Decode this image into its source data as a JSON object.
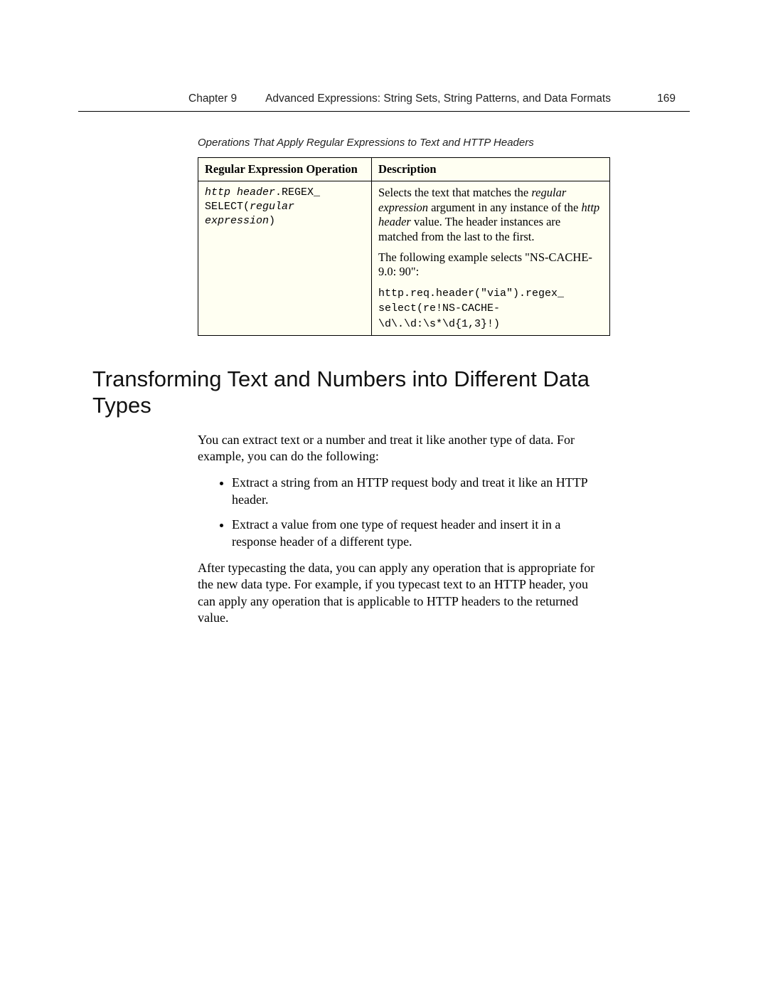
{
  "header": {
    "chapter": "Chapter 9",
    "title": "Advanced Expressions: String Sets, String Patterns, and Data Formats",
    "page": "169"
  },
  "table": {
    "caption": "Operations That Apply Regular Expressions to Text and HTTP Headers",
    "columns": [
      "Regular Expression Operation",
      "Description"
    ],
    "row": {
      "op_prefix_i": "http header",
      "op_mid": ".REGEX_ SELECT(",
      "op_arg_i": "regular expression",
      "op_suffix": ")",
      "desc_p1_a": "Selects the text that matches the ",
      "desc_p1_i1": "regular expression",
      "desc_p1_b": " argument in any instance of the ",
      "desc_p1_i2": "http header",
      "desc_p1_c": " value. The header instances are matched from the last to the first.",
      "desc_p2": "The following example selects \"NS-CACHE-9.0: 90\":",
      "desc_code": "http.req.header(\"via\").regex_\nselect(re!NS-CACHE-\n\\d\\.\\d:\\s*\\d{1,3}!)"
    }
  },
  "section": {
    "heading": "Transforming Text and Numbers into Different Data Types",
    "p1": "You can extract text or a number and treat it like another type of data. For example, you can do the following:",
    "bullets": [
      "Extract a string from an HTTP request body and treat it like an HTTP header.",
      "Extract a value from one type of request header and insert it in a response header of a different type."
    ],
    "p2": "After typecasting the data, you can apply any operation that is appropriate for the new data type. For example, if you typecast text to an HTTP header, you can apply any operation that is applicable to HTTP headers to the returned value."
  }
}
